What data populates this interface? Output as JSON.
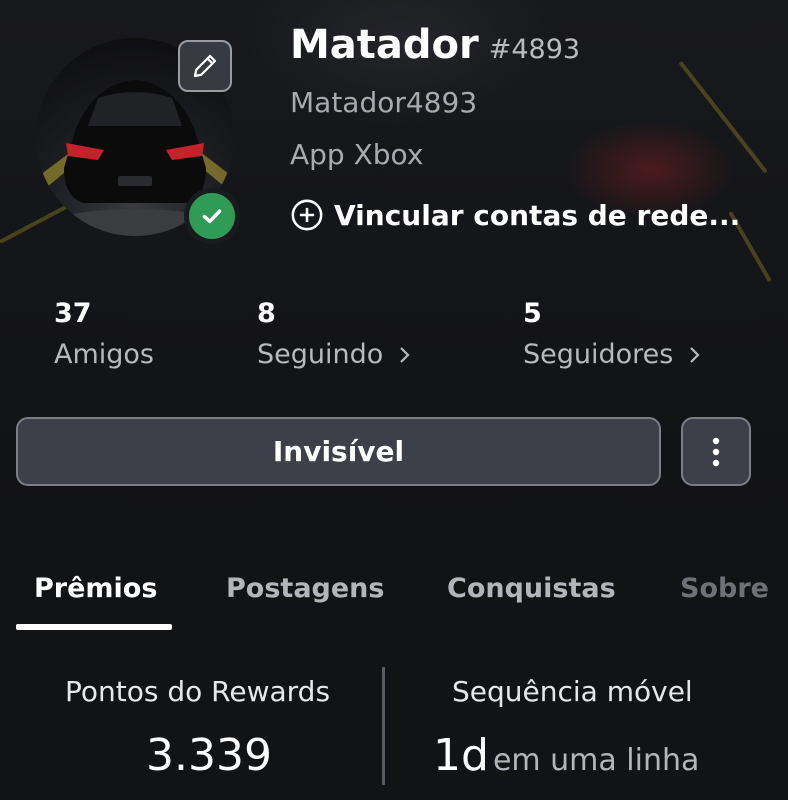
{
  "profile": {
    "name": "Matador",
    "tag": "#4893",
    "gamertag": "Matador4893",
    "app": "App Xbox",
    "link_label": "Vincular contas de rede...",
    "presence_color": "#2f9b55"
  },
  "stats": [
    {
      "value": "37",
      "label": "Amigos",
      "chevron": false
    },
    {
      "value": "8",
      "label": "Seguindo",
      "chevron": true
    },
    {
      "value": "5",
      "label": "Seguidores",
      "chevron": true
    }
  ],
  "actions": {
    "status_button": "Invisível",
    "more_icon": "more-vertical-icon"
  },
  "tabs": [
    {
      "label": "Prêmios",
      "active": true
    },
    {
      "label": "Postagens",
      "active": false
    },
    {
      "label": "Conquistas",
      "active": false
    },
    {
      "label": "Sobre",
      "active": false
    }
  ],
  "rewards": {
    "points_title": "Pontos do Rewards",
    "points_value": "3.339",
    "streak_title": "Sequência móvel",
    "streak_value": "1d",
    "streak_suffix": "em uma linha"
  },
  "icons": {
    "edit": "pencil-icon",
    "presence": "check-circle-icon",
    "link": "plus-circle-icon",
    "chevron": "chevron-right-icon"
  }
}
